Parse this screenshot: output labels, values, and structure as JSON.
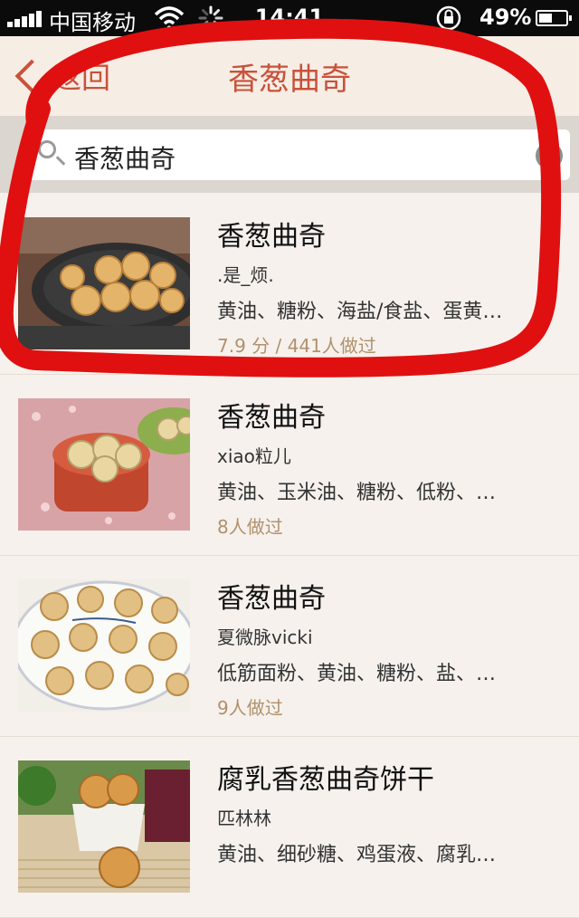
{
  "status_bar": {
    "carrier": "中国移动",
    "time": "14:41",
    "battery_percent": "49%",
    "battery_level": 0.49,
    "icons": [
      "signal-icon",
      "wifi-icon",
      "activity-spinner-icon",
      "rotation-lock-icon",
      "battery-icon"
    ]
  },
  "nav": {
    "back_label": "返回",
    "title": "香葱曲奇"
  },
  "search": {
    "query": "香葱曲奇",
    "clear_label": "×"
  },
  "results": [
    {
      "name": "香葱曲奇",
      "author": ".是_烦.",
      "ingredients": "黄油、糖粉、海盐/食盐、蛋黄…",
      "cooks": "7.9 分 / 441人做过"
    },
    {
      "name": "香葱曲奇",
      "author": "xiao粒儿",
      "ingredients": "黄油、玉米油、糖粉、低粉、…",
      "cooks": "8人做过"
    },
    {
      "name": "香葱曲奇",
      "author": "夏微脉vicki",
      "ingredients": "低筋面粉、黄油、糖粉、盐、…",
      "cooks": "9人做过"
    },
    {
      "name": "腐乳香葱曲奇饼干",
      "author": "匹林林",
      "ingredients": "黄油、细砂糖、鸡蛋液、腐乳…",
      "cooks": ""
    }
  ],
  "colors": {
    "accent": "#c8523a",
    "annotation": "#e01010",
    "meta": "#b0916c"
  }
}
